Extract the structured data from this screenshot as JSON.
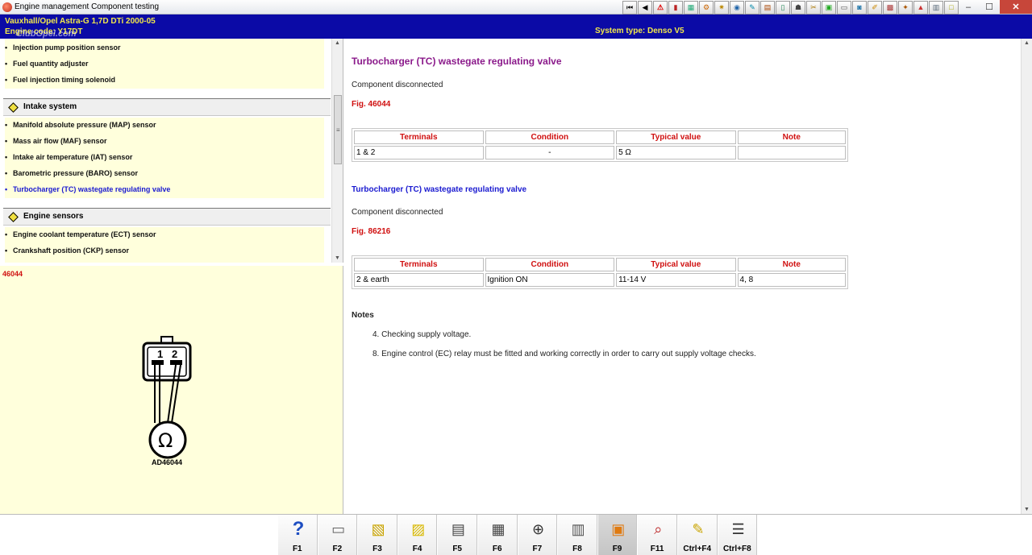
{
  "window": {
    "title": "Engine management Component testing",
    "controls": {
      "minimize": "–",
      "maximize": "☐",
      "close": "✕"
    }
  },
  "toolbar_icons": [
    "first-page-icon",
    "previous-page-icon",
    "warning-icon",
    "book-icon",
    "chart-icon",
    "gear-icon",
    "settings-icon",
    "circle-icon",
    "tool-icon",
    "engine-icon",
    "door-icon",
    "person-icon",
    "wrench-icon",
    "battery-icon",
    "printer-icon",
    "disk-icon",
    "edit-icon",
    "image-icon",
    "ignition-icon",
    "road-icon",
    "document-icon",
    "note-icon"
  ],
  "header": {
    "vehicle": "Vauxhall/Opel   Astra-G   1,7D DTi 2000-05",
    "engine": "Engine code: Y17DT",
    "system_type": "System type: Denso V5",
    "watermark": "ClubOpel.com"
  },
  "nav": {
    "top_items": [
      "Injection pump position sensor",
      "Fuel quantity adjuster",
      "Fuel injection timing solenoid"
    ],
    "groups": [
      {
        "label": "Intake system",
        "items": [
          "Manifold absolute pressure (MAP) sensor",
          "Mass air flow (MAF) sensor",
          "Intake air temperature (IAT) sensor",
          "Barometric pressure (BARO) sensor",
          "Turbocharger (TC) wastegate regulating valve"
        ]
      },
      {
        "label": "Engine sensors",
        "items": [
          "Engine coolant temperature (ECT) sensor",
          "Crankshaft position (CKP) sensor"
        ]
      }
    ]
  },
  "image_pane": {
    "figure_id": "46044",
    "pins": [
      "1",
      "2"
    ],
    "meter_symbol": "Ω",
    "caption": "AD46044"
  },
  "content": {
    "title": "Turbocharger (TC) wastegate regulating valve",
    "section1": {
      "status": "Component disconnected",
      "figure": "Fig. 46044",
      "headers": [
        "Terminals",
        "Condition",
        "Typical value",
        "Note"
      ],
      "row": [
        "1 & 2",
        "-",
        "5 Ω",
        ""
      ]
    },
    "section2": {
      "heading": "Turbocharger (TC) wastegate regulating valve",
      "status": "Component disconnected",
      "figure": "Fig. 86216",
      "headers": [
        "Terminals",
        "Condition",
        "Typical value",
        "Note"
      ],
      "row": [
        "2 & earth",
        "Ignition ON",
        "11-14 V",
        "4, 8"
      ]
    },
    "notes_heading": "Notes",
    "notes": [
      "4. Checking supply voltage.",
      "8. Engine control (EC) relay must be fitted and working correctly in order to carry out supply voltage checks."
    ]
  },
  "function_keys": [
    {
      "label": "F1",
      "icon": "help-icon"
    },
    {
      "label": "F2",
      "icon": "printer-icon"
    },
    {
      "label": "F3",
      "icon": "copy-image-icon"
    },
    {
      "label": "F4",
      "icon": "yellow-image-icon"
    },
    {
      "label": "F5",
      "icon": "component-icon"
    },
    {
      "label": "F6",
      "icon": "connector-icon"
    },
    {
      "label": "F7",
      "icon": "zoom-icon"
    },
    {
      "label": "F8",
      "icon": "book-icon"
    },
    {
      "label": "F9",
      "icon": "orange-panel-icon"
    },
    {
      "label": "F11",
      "icon": "search-person-icon"
    },
    {
      "label": "Ctrl+F4",
      "icon": "notepad-icon"
    },
    {
      "label": "Ctrl+F8",
      "icon": "table-icon"
    }
  ]
}
